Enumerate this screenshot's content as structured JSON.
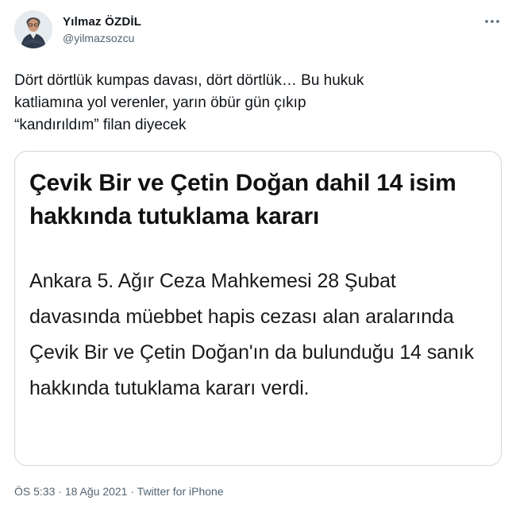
{
  "user": {
    "display_name": "Yılmaz ÖZDİL",
    "handle": "@yilmazsozcu",
    "avatar_icon": "user-avatar"
  },
  "header": {
    "more_icon": "more-horizontal-icon"
  },
  "tweet": {
    "text": "Dört dörtlük kumpas davası, dört dörtlük… Bu hukuk\nkatliamına yol verenler, yarın öbür gün çıkıp\n“kandırıldım” filan diyecek"
  },
  "media": {
    "headline": "Çevik Bir ve Çetin Doğan dahil 14 isim hakkında tutuklama kararı",
    "body": "Ankara 5. Ağır Ceza Mahkemesi 28 Şubat davasında müebbet hapis cezası alan aralarında Çevik Bir ve Çetin Doğan'ın da bulunduğu 14 sanık hakkında tutuklama kararı verdi."
  },
  "meta": {
    "time": "ÖS 5:33",
    "separator": " · ",
    "date": "18 Ağu 2021",
    "source": "Twitter for iPhone"
  },
  "colors": {
    "text": "#0f1419",
    "secondary": "#536471",
    "border": "#cfd9de"
  }
}
